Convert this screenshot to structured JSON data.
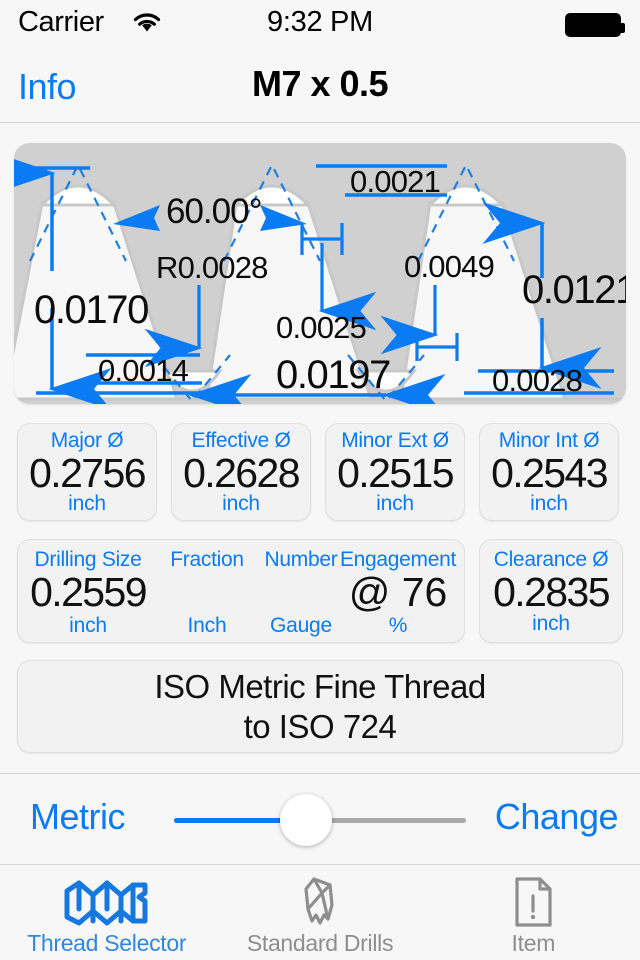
{
  "status_bar": {
    "carrier": "Carrier",
    "wifi_icon": "wifi-icon",
    "time": "9:32 PM",
    "battery_icon": "battery-full-icon"
  },
  "nav_bar": {
    "back_label": "Info",
    "title": "M7 x 0.5"
  },
  "diagram": {
    "name": "thread-profile-diagram",
    "angle": "60.00°",
    "root_radius": "R0.0028",
    "thread_height": "0.0170",
    "root_flat": "0.0014",
    "crest_truncation": "0.0021",
    "crest_flat": "0.0025",
    "pitch": "0.0197",
    "root_truncation": "0.0049",
    "engagement_depth": "0.0121",
    "minor_offset": "0.0028",
    "colors": {
      "accent": "#0a7bf2",
      "panel_bg": "#d0d0d0",
      "thread_fill": "#f7f7f7"
    }
  },
  "measurements": {
    "row1": [
      {
        "label": "Major Ø",
        "value": "0.2756",
        "unit": "inch"
      },
      {
        "label": "Effective Ø",
        "value": "0.2628",
        "unit": "inch"
      },
      {
        "label": "Minor Ext Ø",
        "value": "0.2515",
        "unit": "inch"
      },
      {
        "label": "Minor Int Ø",
        "value": "0.2543",
        "unit": "inch"
      }
    ],
    "row2": [
      {
        "label": "Drilling Size",
        "value": "0.2559",
        "unit": "inch"
      },
      {
        "label": "Fraction",
        "value": "",
        "unit": "Inch"
      },
      {
        "label": "Number",
        "value": "",
        "unit": "Gauge"
      },
      {
        "label": "Engagement",
        "value": "@  76",
        "unit": "%"
      }
    ],
    "clearance": {
      "label": "Clearance Ø",
      "value": "0.2835",
      "unit": "inch"
    }
  },
  "description": {
    "line1": "ISO Metric Fine Thread",
    "line2": "to ISO 724"
  },
  "slider_row": {
    "left_label": "Metric",
    "right_label": "Change"
  },
  "tab_bar": {
    "tabs": [
      {
        "label": "Thread Selector",
        "icon": "screw-thread-icon",
        "active": true
      },
      {
        "label": "Standard Drills",
        "icon": "drill-bit-icon",
        "active": false
      },
      {
        "label": "Item",
        "icon": "document-info-icon",
        "active": false
      }
    ]
  }
}
